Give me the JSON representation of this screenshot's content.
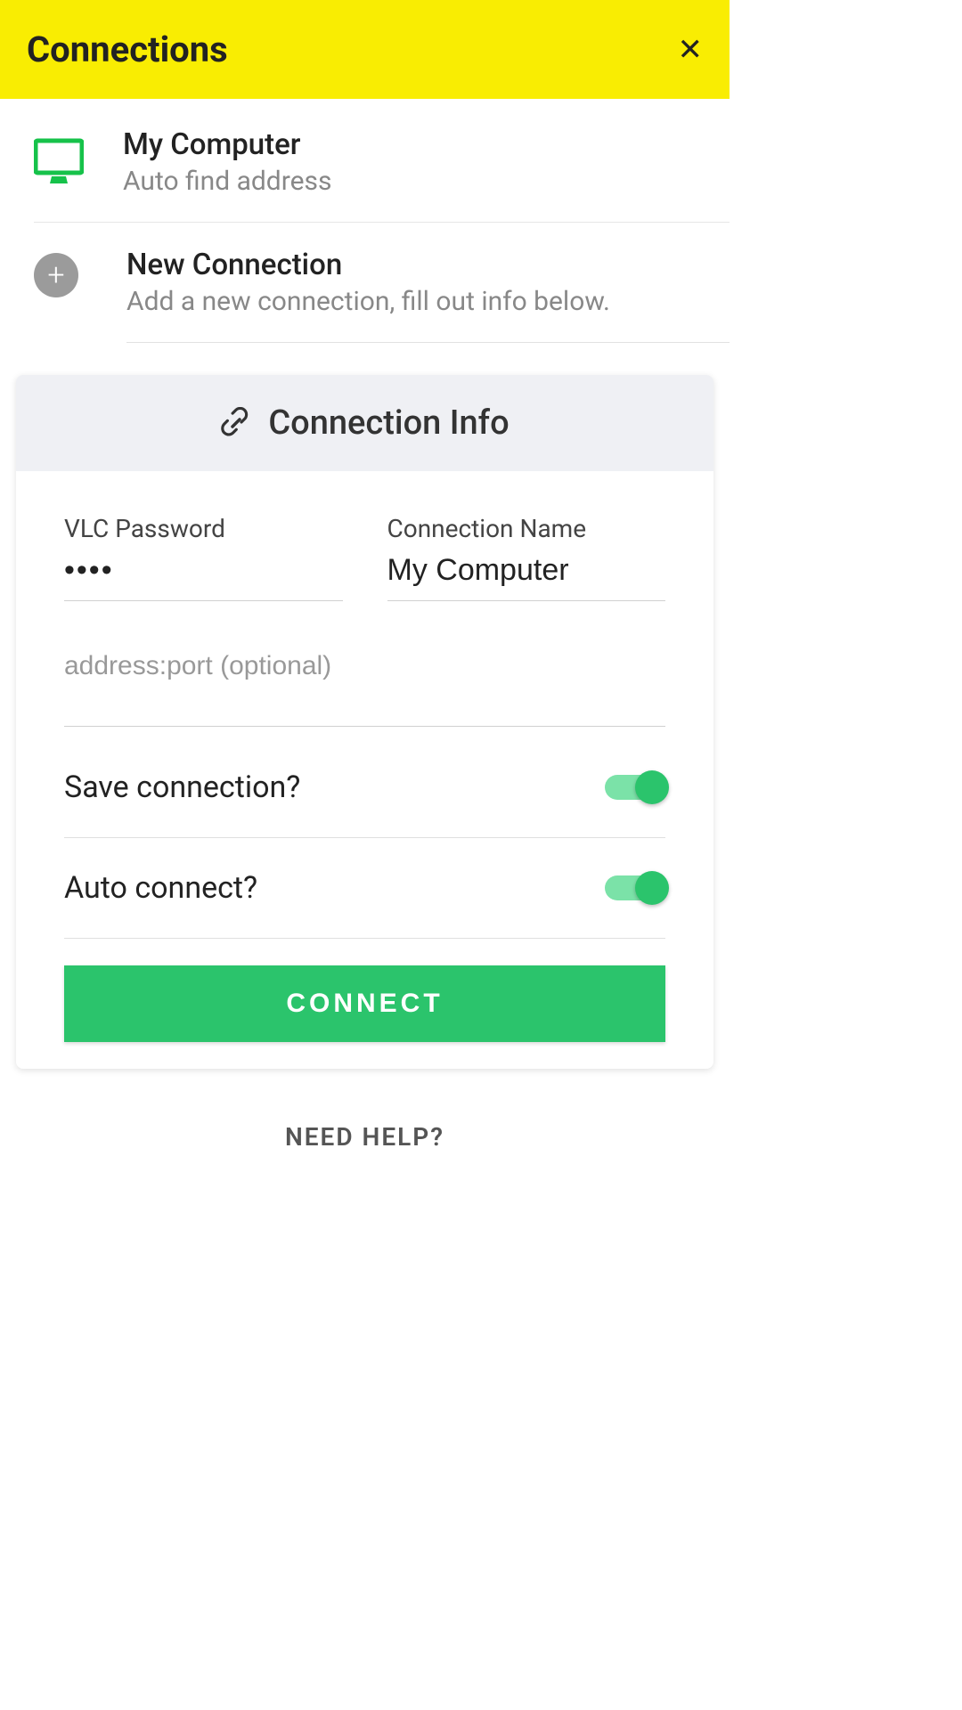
{
  "header": {
    "title": "Connections"
  },
  "myComputer": {
    "title": "My Computer",
    "subtitle": "Auto find address"
  },
  "newConnection": {
    "title": "New Connection",
    "subtitle": "Add a new connection, fill out info below."
  },
  "card": {
    "headerTitle": "Connection Info",
    "fields": {
      "passwordLabel": "VLC Password",
      "passwordValue": "••••",
      "nameLabel": "Connection Name",
      "nameValue": "My Computer",
      "addressPlaceholder": "address:port (optional)",
      "addressValue": ""
    },
    "toggles": {
      "saveLabel": "Save connection?",
      "saveValue": true,
      "autoLabel": "Auto connect?",
      "autoValue": true
    },
    "connectLabel": "CONNECT"
  },
  "help": {
    "label": "NEED HELP?"
  }
}
